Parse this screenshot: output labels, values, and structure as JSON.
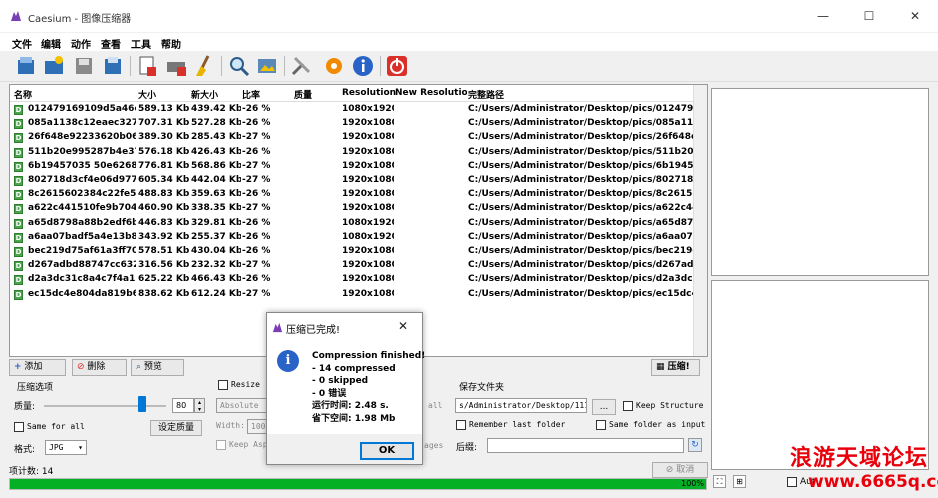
{
  "titlebar": {
    "title": "Caesium - 图像压缩器",
    "minimize_glyph": "—",
    "maximize_glyph": "☐",
    "close_glyph": "✕"
  },
  "menu": [
    "文件",
    "编辑",
    "动作",
    "查看",
    "工具",
    "帮助"
  ],
  "toolbar_icons": [
    "add-file-icon",
    "add-folder-icon",
    "save-icon",
    "export-icon",
    "remove-item-icon",
    "clear-list-icon",
    "clean-icon",
    "search-icon",
    "preview-icon",
    "settings-tools-icon",
    "plugin-gear-icon",
    "info-icon",
    "power-exit-icon"
  ],
  "colors": {
    "accent": "#0078d7",
    "progress": "#06b025",
    "file_icon": "#4aa64a",
    "exit": "#d9302a",
    "info": "#2a63c7",
    "watermark": "#e8000b"
  },
  "list": {
    "headers": [
      "名称",
      "大小",
      "新大小",
      "比率",
      "质量",
      "Resolution",
      "New Resolution",
      "完整路径"
    ],
    "file_icon_glyph": "D",
    "rows": [
      [
        "012479169109d5a46c...",
        "589.13 Kb",
        "439.42 Kb",
        "-26 %",
        "",
        "1080x1920",
        "",
        "C:/Users/Administrator/Desktop/pics/0124791691..."
      ],
      [
        "085a1138c12eaec327...",
        "707.31 Kb",
        "527.28 Kb",
        "-26 %",
        "",
        "1920x1080",
        "",
        "C:/Users/Administrator/Desktop/pics/085a1138c1..."
      ],
      [
        "26f648e92233620b06...",
        "389.30 Kb",
        "285.43 Kb",
        "-27 %",
        "",
        "1920x1080",
        "",
        "C:/Users/Administrator/Desktop/pics/26f648e922..."
      ],
      [
        "511b20e995287b4e37...",
        "576.18 Kb",
        "426.43 Kb",
        "-26 %",
        "",
        "1920x1080",
        "",
        "C:/Users/Administrator/Desktop/pics/511b20e995..."
      ],
      [
        "6b19457035 50e6268...",
        "776.81 Kb",
        "568.86 Kb",
        "-27 %",
        "",
        "1920x1080",
        "",
        "C:/Users/Administrator/Desktop/pics/6b19457703..."
      ],
      [
        "802718d3cf4e06d977...",
        "605.34 Kb",
        "442.04 Kb",
        "-27 %",
        "",
        "1920x1080",
        "",
        "C:/Users/Administrator/Desktop/pics/802718d3cf..."
      ],
      [
        "8c2615602384c22fe5a...",
        "488.83 Kb",
        "359.63 Kb",
        "-26 %",
        "",
        "1920x1080",
        "",
        "C:/Users/Administrator/Desktop/pics/8c26156023..."
      ],
      [
        "a622c441510fe9b704...",
        "460.90 Kb",
        "338.35 Kb",
        "-27 %",
        "",
        "1920x1080",
        "",
        "C:/Users/Administrator/Desktop/pics/a622c44151..."
      ],
      [
        "a65d8798a88b2edf6b...",
        "446.83 Kb",
        "329.81 Kb",
        "-26 %",
        "",
        "1080x1920",
        "",
        "C:/Users/Administrator/Desktop/pics/a65d8798a8..."
      ],
      [
        "a6aa07badf5a4e13b8...",
        "343.92 Kb",
        "255.37 Kb",
        "-26 %",
        "",
        "1080x1920",
        "",
        "C:/Users/Administrator/Desktop/pics/a6aa07badf..."
      ],
      [
        "bec219d75af61a3ff70...",
        "578.51 Kb",
        "430.04 Kb",
        "-26 %",
        "",
        "1920x1080",
        "",
        "C:/Users/Administrator/Desktop/pics/bec219d75a..."
      ],
      [
        "d267adbd88747cc632...",
        "316.56 Kb",
        "232.32 Kb",
        "-27 %",
        "",
        "1920x1080",
        "",
        "C:/Users/Administrator/Desktop/pics/d267adbd8..."
      ],
      [
        "d2a3dc31c8a4c7f4a1...",
        "625.22 Kb",
        "466.43 Kb",
        "-26 %",
        "",
        "1920x1080",
        "",
        "C:/Users/Administrator/Desktop/pics/d2a3dc31c8..."
      ],
      [
        "ec15dc4e804da819b6...",
        "838.62 Kb",
        "612.24 Kb",
        "-27 %",
        "",
        "1920x1080",
        "",
        "C:/Users/Administrator/Desktop/pics/ec15dc4e80..."
      ]
    ]
  },
  "actions": {
    "add": "添加",
    "remove": "删除",
    "preview": "预览",
    "compress": "压缩!"
  },
  "compression": {
    "title": "压缩选项",
    "quality_label": "质量:",
    "quality_value": "80",
    "quality_level": 0.8,
    "same_for_all": "Same for all",
    "set_quality": "设定质量",
    "format_label": "格式:",
    "format_value": "JPG"
  },
  "resize": {
    "title": "Resize",
    "mode": "Absolute",
    "all_text": "all",
    "width_label": "Width:",
    "width_value": "100",
    "keep_aspect": "Keep Asp",
    "ages_text": "ages"
  },
  "save": {
    "title": "保存文件夹",
    "path": "s/Administrator/Desktop/11111",
    "browse": "...",
    "keep_structure": "Keep Structure",
    "remember_last": "Remember last folder",
    "same_as_input": "Same folder as input",
    "suffix_label": "后缀:",
    "suffix_value": ""
  },
  "status": {
    "item_count": "项计数: 14",
    "cancel": "取消",
    "progress_label": "100%",
    "progress_value": 1.0,
    "auto_text": "Aut"
  },
  "dialog": {
    "title": "压缩已完成!",
    "close_glyph": "✕",
    "info_glyph": "i",
    "lines": [
      "Compression finished!",
      "- 14 compressed",
      "- 0 skipped",
      "- 0 错误",
      "运行时间: 2.48 s.",
      "省下空间: 1.98 Mb"
    ],
    "ok": "OK"
  },
  "watermark": {
    "cn": "浪游天域论坛",
    "url": "www.6665q.com"
  }
}
